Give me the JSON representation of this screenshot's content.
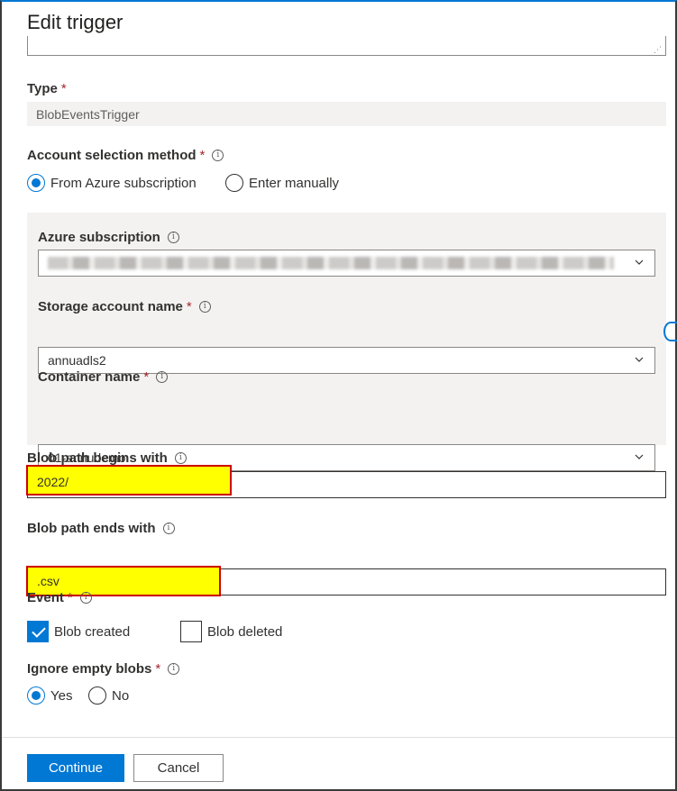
{
  "dialog": {
    "title": "Edit trigger"
  },
  "type_field": {
    "label": "Type",
    "required": "*",
    "value": "BlobEventsTrigger"
  },
  "account_selection": {
    "label": "Account selection method",
    "required": "*",
    "options": [
      {
        "label": "From Azure subscription",
        "selected": true
      },
      {
        "label": "Enter manually",
        "selected": false
      }
    ]
  },
  "azure_subscription": {
    "label": "Azure subscription"
  },
  "storage_account": {
    "label": "Storage account name",
    "required": "*",
    "value": "annuadls2"
  },
  "container": {
    "label": "Container name",
    "required": "*",
    "value": "01-annudemo"
  },
  "blob_begins": {
    "label": "Blob path begins with",
    "value": "2022/"
  },
  "blob_ends": {
    "label": "Blob path ends with",
    "value": ".csv"
  },
  "event": {
    "label": "Event",
    "required": "*",
    "options": [
      {
        "label": "Blob created",
        "checked": true
      },
      {
        "label": "Blob deleted",
        "checked": false
      }
    ]
  },
  "ignore_empty": {
    "label": "Ignore empty blobs",
    "required": "*",
    "options": [
      {
        "label": "Yes",
        "selected": true
      },
      {
        "label": "No",
        "selected": false
      }
    ]
  },
  "footer": {
    "continue_label": "Continue",
    "cancel_label": "Cancel"
  },
  "icons": {
    "info": "info-icon",
    "chevron": "chevron-down-icon",
    "refresh": "refresh-icon"
  },
  "colors": {
    "accent": "#0078d4",
    "highlight": "#ffff00",
    "highlight_border": "#cc0000",
    "required": "#a4262c"
  }
}
